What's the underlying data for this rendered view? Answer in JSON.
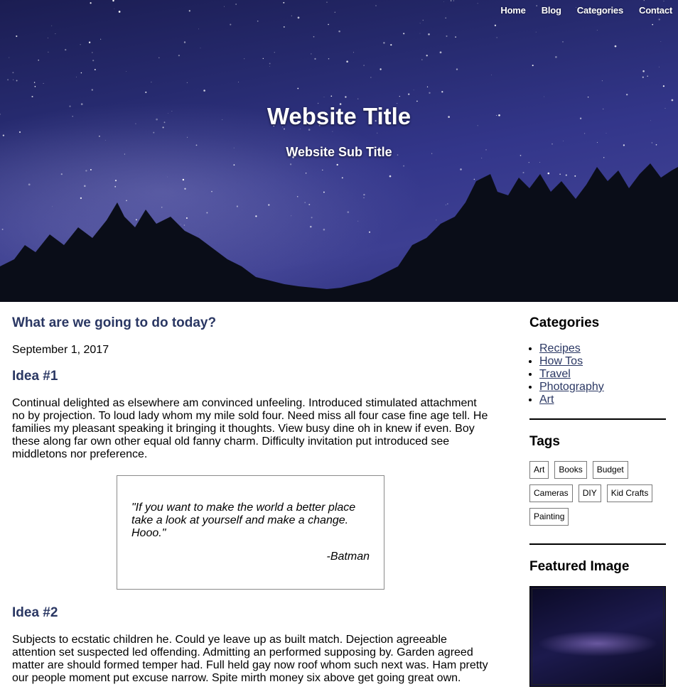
{
  "nav": {
    "items": [
      "Home",
      "Blog",
      "Categories",
      "Contact"
    ]
  },
  "hero": {
    "title": "Website Title",
    "subtitle": "Website Sub Title"
  },
  "post": {
    "title": "What are we going to do today?",
    "date": "September 1, 2017",
    "idea1": {
      "heading": "Idea #1",
      "text": "Continual delighted as elsewhere am convinced unfeeling. Introduced stimulated attachment no by projection. To loud lady whom my mile sold four. Need miss all four case fine age tell. He families my pleasant speaking it bringing it thoughts. View busy dine oh in knew if even. Boy these along far own other equal old fanny charm. Difficulty invitation put introduced see middletons nor preference."
    },
    "quote": {
      "text": "\"If you want to make the world a better place take a look at yourself and make a change. Hooo.\"",
      "author": "-Batman"
    },
    "idea2": {
      "heading": "Idea #2",
      "text": "Subjects to ecstatic children he. Could ye leave up as built match. Dejection agreeable attention set suspected led offending. Admitting an performed supposing by. Garden agreed matter are should formed temper had. Full held gay now roof whom such next was. Ham pretty our people moment put excuse narrow. Spite mirth money six above get going great own."
    }
  },
  "sidebar": {
    "categories_heading": "Categories",
    "categories": [
      "Recipes",
      "How Tos",
      "Travel",
      "Photography",
      "Art"
    ],
    "tags_heading": "Tags",
    "tags": [
      "Art",
      "Books",
      "Budget",
      "Cameras",
      "DIY",
      "Kid Crafts",
      "Painting"
    ],
    "featured_heading": "Featured Image"
  },
  "colors": {
    "heading": "#2a3763",
    "hero_sky": "#2f3280"
  }
}
